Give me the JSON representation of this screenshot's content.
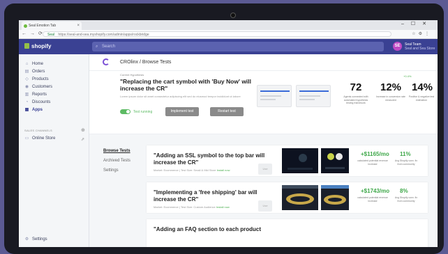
{
  "browser": {
    "tab_title": "Seal Emotion Tab",
    "url_secure": "Seal",
    "url": "https://seal-and-sea.myshopify.com/admin/apps/rockbridge"
  },
  "topbar": {
    "logo": "shopify",
    "search_placeholder": "Search",
    "avatar_initials": "SE",
    "user_name": "Seal Team",
    "user_store": "Seal and Sea Store"
  },
  "sidebar": {
    "items": [
      {
        "label": "Home",
        "icon": "home-icon",
        "glyph": "⌂"
      },
      {
        "label": "Orders",
        "icon": "orders-icon",
        "glyph": "▤"
      },
      {
        "label": "Products",
        "icon": "products-icon",
        "glyph": "◇"
      },
      {
        "label": "Customers",
        "icon": "customers-icon",
        "glyph": "◉"
      },
      {
        "label": "Reports",
        "icon": "reports-icon",
        "glyph": "▥"
      },
      {
        "label": "Discounts",
        "icon": "discounts-icon",
        "glyph": "◔"
      },
      {
        "label": "Apps",
        "icon": "apps-icon",
        "glyph": "▦"
      }
    ],
    "sales_channels_title": "SALES CHANNELS",
    "online_store": "Online Store",
    "settings": "Settings"
  },
  "content": {
    "title": "CROlinx / Browse Tests"
  },
  "hero": {
    "label": "Current Hypothesis",
    "title": "\"Replacing the cart symbol with 'Buy Now' will increase the CR\"",
    "description": "Lorem ipsum dolor sit amet consectetur adipiscing elit sed do eiusmod tempor incididunt ut labore",
    "toggle_label": "Test running",
    "btn_implement": "Implement test",
    "btn_restart": "Restart test",
    "stat1_value": "72",
    "stat1_sub": "Agents connected with automated hypothesis testing framework",
    "stat2_value": "12%",
    "stat2_sub": "Increase in conversion rate measured",
    "stat3_note": "+0.4%",
    "stat3_value": "14%",
    "stat3_sub": "Positive & negative test estimation"
  },
  "lower": {
    "tabs": [
      "Browse Tests",
      "Archived Tests",
      "Settings"
    ],
    "cards": [
      {
        "title": "\"Adding an SSL symbol to the top bar will increase the CR\"",
        "meta": "Market: Ecommerce | Test Size: Small & Mid Store",
        "meta_link": "Install now",
        "button": "Use",
        "value1": "+$1165/mo",
        "sub1": "calculated potential revenue increase",
        "value2": "11%",
        "sub2": "Avg Shopify conv. fix from community"
      },
      {
        "title": "\"Implementing a 'free shipping' bar will increase the CR\"",
        "meta": "Market: Ecommerce | Test Size: Custom Audience",
        "meta_link": "Install now",
        "button": "Use",
        "value1": "+$1743/mo",
        "sub1": "calculated potential revenue increase",
        "value2": "8%",
        "sub2": "Avg Shopify conv. fix from community"
      },
      {
        "title": "\"Adding an FAQ section to each product"
      }
    ]
  },
  "colors": {
    "topbar": "#3a4193",
    "accent_green": "#3fa84a",
    "toggle": "#5dbb64",
    "background": "#5b5a93"
  }
}
